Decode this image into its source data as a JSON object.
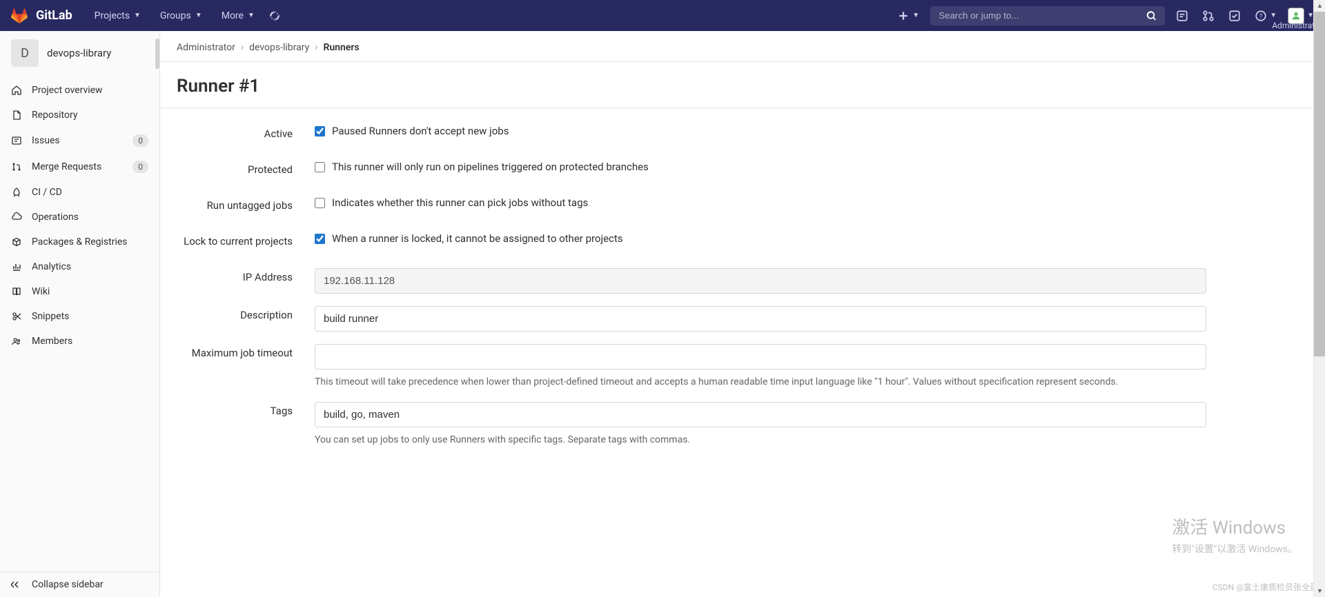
{
  "navbar": {
    "brand": "GitLab",
    "items": [
      "Projects",
      "Groups",
      "More"
    ],
    "search_placeholder": "Search or jump to...",
    "user": "Administrator"
  },
  "sidebar": {
    "project_letter": "D",
    "project_name": "devops-library",
    "items": [
      {
        "label": "Project overview",
        "icon": "home",
        "badge": null
      },
      {
        "label": "Repository",
        "icon": "file",
        "badge": null
      },
      {
        "label": "Issues",
        "icon": "issues",
        "badge": "0"
      },
      {
        "label": "Merge Requests",
        "icon": "merge",
        "badge": "0"
      },
      {
        "label": "CI / CD",
        "icon": "rocket",
        "badge": null
      },
      {
        "label": "Operations",
        "icon": "cloud",
        "badge": null
      },
      {
        "label": "Packages & Registries",
        "icon": "package",
        "badge": null
      },
      {
        "label": "Analytics",
        "icon": "chart",
        "badge": null
      },
      {
        "label": "Wiki",
        "icon": "book",
        "badge": null
      },
      {
        "label": "Snippets",
        "icon": "scissors",
        "badge": null
      },
      {
        "label": "Members",
        "icon": "members",
        "badge": null
      }
    ],
    "collapse_label": "Collapse sidebar"
  },
  "breadcrumb": [
    "Administrator",
    "devops-library",
    "Runners"
  ],
  "page_title": "Runner #1",
  "form": {
    "active": {
      "label": "Active",
      "desc": "Paused Runners don't accept new jobs",
      "checked": true
    },
    "protected": {
      "label": "Protected",
      "desc": "This runner will only run on pipelines triggered on protected branches",
      "checked": false
    },
    "untagged": {
      "label": "Run untagged jobs",
      "desc": "Indicates whether this runner can pick jobs without tags",
      "checked": false
    },
    "lock": {
      "label": "Lock to current projects",
      "desc": "When a runner is locked, it cannot be assigned to other projects",
      "checked": true
    },
    "ip": {
      "label": "IP Address",
      "value": "192.168.11.128"
    },
    "description": {
      "label": "Description",
      "value": "build runner"
    },
    "timeout": {
      "label": "Maximum job timeout",
      "value": "",
      "help": "This timeout will take precedence when lower than project-defined timeout and accepts a human readable time input language like \"1 hour\". Values without specification represent seconds."
    },
    "tags": {
      "label": "Tags",
      "value": "build, go, maven",
      "help": "You can set up jobs to only use Runners with specific tags. Separate tags with commas."
    }
  },
  "watermark": {
    "title": "激活 Windows",
    "sub": "转到\"设置\"以激活 Windows。"
  },
  "csdn": "CSDN @富士康质检员张全蛋"
}
